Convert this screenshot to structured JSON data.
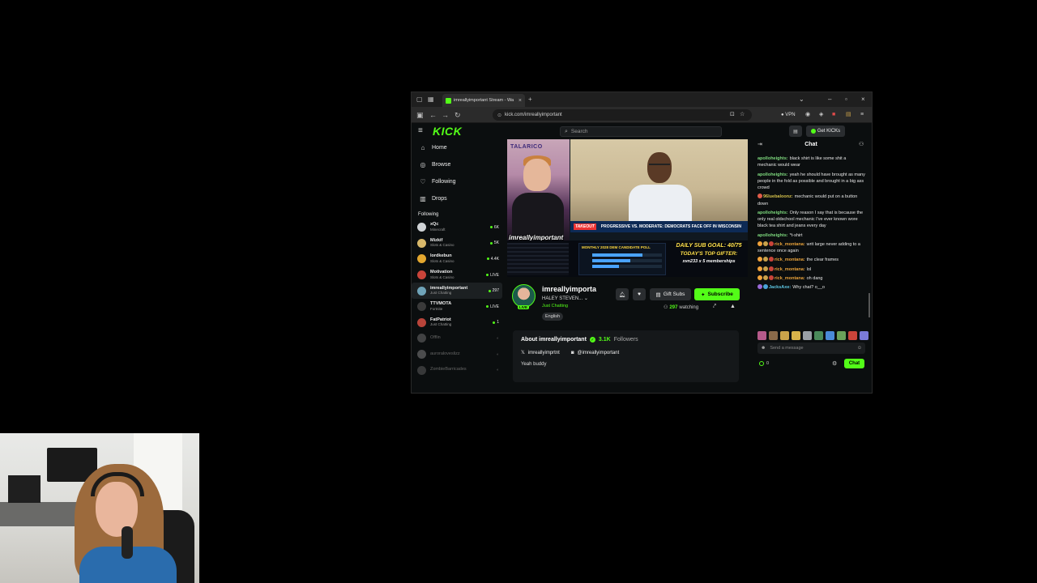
{
  "browser": {
    "tab_title": "imreallyimportant Stream - Wa",
    "url": "kick.com/imreallyimportant",
    "vpn_label": "VPN"
  },
  "kick": {
    "logo": "KICK",
    "search_placeholder": "Search",
    "get_kicks_label": "Get KICKs",
    "nav": [
      {
        "label": "Home",
        "icon": "home-icon"
      },
      {
        "label": "Browse",
        "icon": "compass-icon"
      },
      {
        "label": "Following",
        "icon": "heart-icon"
      },
      {
        "label": "Drops",
        "icon": "drops-icon"
      }
    ],
    "following_header": "Following",
    "channels": [
      {
        "name": "xQc",
        "category": "Minecraft",
        "stat": "6K",
        "color": "#cfd3d6"
      },
      {
        "name": "Mizkif",
        "category": "Slots & Casino",
        "stat": "5K",
        "color": "#d8b86a"
      },
      {
        "name": "lordkebun",
        "category": "Slots & Casino",
        "stat": "4.4K",
        "color": "#e3a72f"
      },
      {
        "name": "Motivation",
        "category": "Slots & Casino",
        "stat": "LIVE",
        "color": "#c9443a"
      },
      {
        "name": "imreallyimportant",
        "category": "Just Chatting",
        "stat": "297",
        "color": "#6fa3b8"
      },
      {
        "name": "TTVMOTA",
        "category": "Fortnite",
        "stat": "LIVE",
        "color": "#3a3a3a"
      },
      {
        "name": "FatPatriot",
        "category": "Just Chatting",
        "stat": "1",
        "color": "#b8443a"
      }
    ],
    "offline_channels": [
      {
        "name": "Offlin",
        "color": "#666"
      },
      {
        "name": "auroraloveslizz",
        "color": "#777"
      },
      {
        "name": "ZombieBarricades",
        "color": "#555"
      }
    ]
  },
  "video": {
    "sign_text": "TALARICO",
    "host_name": "imreallyimportant",
    "lower_third_logo": "TAKEOUT",
    "lower_third_text": "PROGRESSIVE VS. MODERATE: DEMOCRATS FACE OFF IN WISCONSIN",
    "poll_title": "MONTHLY 2028 DEM CANDIDATE POLL",
    "sub_goal": "DAILY SUB GOAL: 40/75",
    "top_gifter_label": "TODAY'S TOP GIFTER:",
    "top_gifter_value": "xvn233 x 5 memberships"
  },
  "channel": {
    "title": "imreallyimporta",
    "subtitle": "HALEY STEVEN...",
    "category": "Just Chatting",
    "language": "English",
    "live_tag": "LIVE",
    "gift_subs_label": "Gift Subs",
    "subscribe_label": "Subscribe",
    "viewers": "297",
    "viewers_label": "watching",
    "about_title": "About imreallyimportant",
    "followers_count": "3.1K",
    "followers_label": "Followers",
    "twitter": "imreallyimprtnt",
    "instagram": "@imreallyimportant",
    "bio": "Yeah buddy"
  },
  "chat": {
    "title": "Chat",
    "messages": [
      {
        "user": "apolloheights:",
        "text": "black shirt is like some shit a mechanic would wear",
        "color": "#7dd87d",
        "badges": []
      },
      {
        "user": "apolloheights:",
        "text": "yeah he should have brought as many people in the fold as possible and brought in a big ass crowd",
        "color": "#7dd87d",
        "badges": []
      },
      {
        "user": "96luebaloonz:",
        "text": "mechanic would put on a button down",
        "color": "#d4c04a",
        "badges": [
          "#e05c4a"
        ]
      },
      {
        "user": "apolloheights:",
        "text": "Only reason I say that is because the only real oldschool mechanic I've ever known wore black tea shirt and jeans every day",
        "color": "#7dd87d",
        "badges": []
      },
      {
        "user": "apolloheights:",
        "text": "*t-shirt",
        "color": "#7dd87d",
        "badges": []
      },
      {
        "user": "rick_montana:",
        "text": "writ large never adding to a sentence once again",
        "color": "#e8a23a",
        "badges": [
          "#f2a33a",
          "#caa24a",
          "#c9443a"
        ]
      },
      {
        "user": "rick_montana:",
        "text": "the clear frames",
        "color": "#e8a23a",
        "badges": [
          "#f2a33a",
          "#caa24a",
          "#c9443a"
        ]
      },
      {
        "user": "rick_montana:",
        "text": "lol",
        "color": "#e8a23a",
        "badges": [
          "#f2a33a",
          "#caa24a",
          "#c9443a"
        ]
      },
      {
        "user": "rick_montana:",
        "text": "oh dang",
        "color": "#e8a23a",
        "badges": [
          "#f2a33a",
          "#caa24a",
          "#c9443a"
        ]
      },
      {
        "user": "JacksAxe:",
        "text": "Why chat? o__o",
        "color": "#5ec8e5",
        "badges": [
          "#9a6ad8",
          "#4aa3d8"
        ]
      }
    ],
    "emotes": [
      "#b55a8a",
      "#8a6a4a",
      "#c9a24a",
      "#d8b24a",
      "#9aa0a6",
      "#4a8a5a",
      "#4a8ad8",
      "#6aa05a",
      "#c9443a",
      "#7a7ad8"
    ],
    "input_placeholder": "Send a message",
    "points": "0",
    "send_label": "Chat"
  },
  "colors": {
    "accent": "#53fc18",
    "background": "#0b0e0f"
  }
}
